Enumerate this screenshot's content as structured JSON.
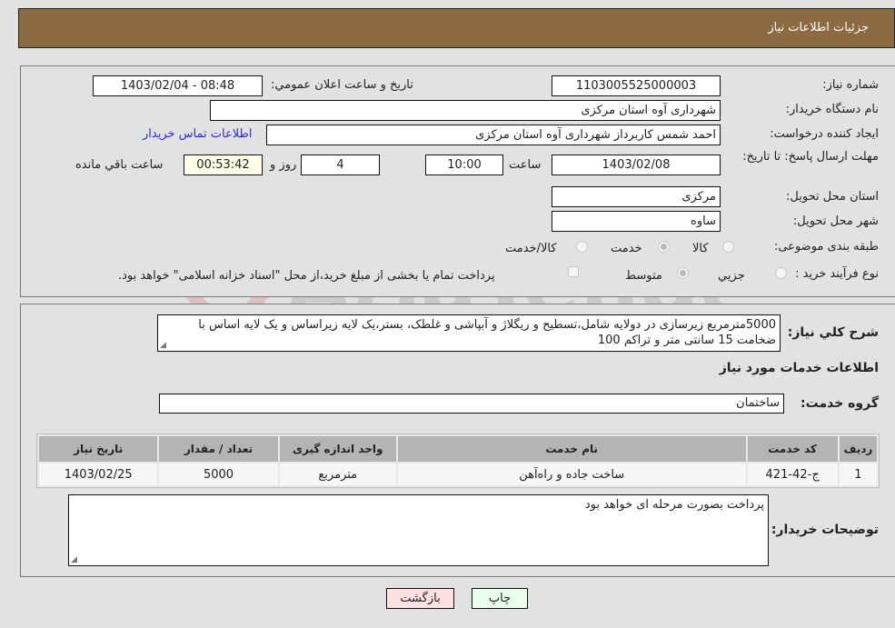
{
  "header": {
    "title": "جزئیات اطلاعات نیاز"
  },
  "need_info": {
    "need_number_label": "شماره نیاز:",
    "need_number": "1103005525000003",
    "announce_label": "تاريخ و ساعت اعلان عمومي:",
    "announce_value": "1403/02/04 - 08:48",
    "buyer_org_label": "نام دستگاه خریدار:",
    "buyer_org": "شهرداری آوه استان مرکزی",
    "requester_label": "ایجاد کننده درخواست:",
    "requester": "احمد  شمس کاربرداز شهرداری آوه استان مرکزی",
    "buyer_contact_link": "اطلاعات تماس خریدار",
    "deadline_label": "مهلت ارسال پاسخ: تا تاریخ:",
    "deadline_date": "1403/02/08",
    "time_label": "ساعت",
    "deadline_time": "10:00",
    "days_value": "4",
    "days_label": "روز و",
    "remaining_time": "00:53:42",
    "remaining_label": "ساعت باقي مانده",
    "province_label": "استان محل تحویل:",
    "province": "مرکزی",
    "city_label": "شهر محل تحویل:",
    "city": "ساوه",
    "category_label": "طبقه بندی موضوعی:",
    "category_options": [
      {
        "label": "کالا",
        "selected": false
      },
      {
        "label": "خدمت",
        "selected": true
      },
      {
        "label": "کالا/خدمت",
        "selected": false
      }
    ],
    "process_label": "نوع فرآیند خرید :",
    "process_options": [
      {
        "label": "جزيي",
        "selected": false
      },
      {
        "label": "متوسط",
        "selected": true
      }
    ],
    "treasury_checkbox_checked": false,
    "treasury_note": "پرداخت تمام یا بخشی از مبلغ خرید،از محل \"اسناد خزانه اسلامی\" خواهد بود."
  },
  "details": {
    "description_label": "شرح كلي نياز:",
    "description": "5000مترمربع زیرسازی در دولایه شامل،تسطیح و ریگلاژ و آبپاشی و غلطک، بستر،یک لایه زیراساس و یک لایه اساس با ضخامت 15 سانتی متر و تراکم 100",
    "services_heading": "اطلاعات خدمات مورد نیاز",
    "service_group_label": "گروه خدمت:",
    "service_group": "ساختمان",
    "table": {
      "columns": [
        "ردیف",
        "کد خدمت",
        "نام خدمت",
        "واحد اندازه گیری",
        "تعداد / مقدار",
        "تاریخ نیاز"
      ],
      "rows": [
        [
          "1",
          "ج-42-421",
          "ساخت جاده و راه‌آهن",
          "مترمربع",
          "5000",
          "1403/02/25"
        ]
      ]
    },
    "buyer_notes_label": "توضیحات خریدار:",
    "buyer_notes": "پرداخت بصورت مرحله ای خواهد بود"
  },
  "buttons": {
    "print": "چاپ",
    "back": "بازگشت"
  },
  "colors": {
    "header_bg": "#8c6b42",
    "print_btn_bg": "#eaffea",
    "back_btn_bg": "#ffe0e0",
    "remaining_bg": "#ffffe8",
    "link": "#2a2ae0"
  },
  "watermark": {
    "text": "AriaTender.neT"
  }
}
